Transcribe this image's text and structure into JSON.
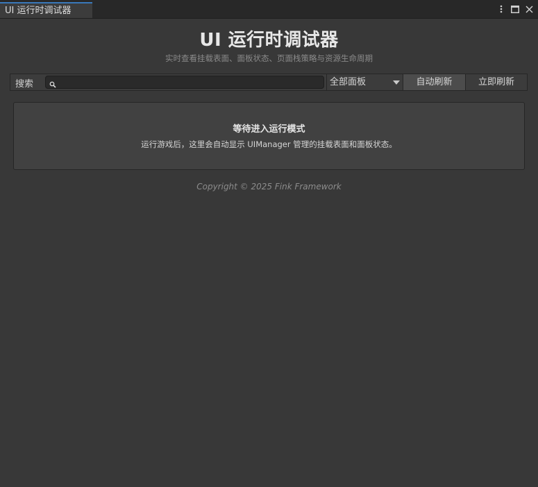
{
  "window": {
    "tab_title": "UI 运行时调试器",
    "controls": [
      "more-icon",
      "maximize-icon",
      "close-icon"
    ]
  },
  "header": {
    "title": "UI 运行时调试器",
    "subtitle": "实时查看挂载表面、面板状态、页面栈策略与资源生命周期"
  },
  "toolbar": {
    "search_label": "搜索",
    "search_value": "",
    "search_placeholder": "",
    "filter_selected": "全部面板",
    "auto_refresh_label": "自动刷新",
    "refresh_now_label": "立即刷新"
  },
  "info": {
    "title": "等待进入运行模式",
    "description": "运行游戏后，这里会自动显示 UIManager 管理的挂载表面和面板状态。"
  },
  "footer": {
    "copyright": "Copyright © 2025 Fink Framework"
  },
  "colors": {
    "background": "#383838",
    "tab_accent": "#3a79bb",
    "toggle_active": "#4c4c4c"
  }
}
